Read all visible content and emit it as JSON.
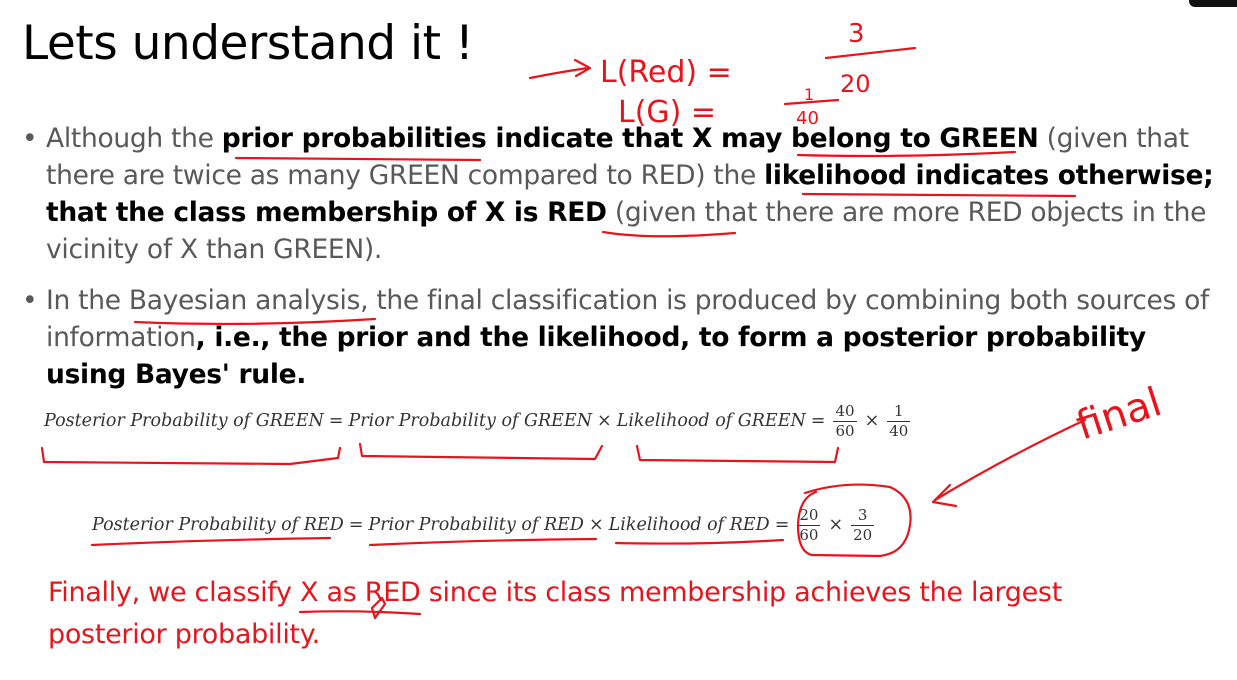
{
  "slide": {
    "title": "Lets understand it !",
    "bullet1": {
      "t1": "Although the ",
      "b1": "prior probabilities indicate that X may belong to GREEN",
      "t2": " (given that there are twice as many GREEN compared to RED) the ",
      "b2": "likelihood indicates otherwise; that the class membership of X is RED",
      "t3": " (given that there are more RED objects in the vicinity of X than GREEN)."
    },
    "bullet2": {
      "t1": "In the Bayesian analysis, the final classification is produced by combining both sources of information",
      "b1": ", i.e., the prior and the likelihood, to form a posterior probability using Bayes' rule."
    },
    "formula_green": {
      "posterior": "Posterior Probability of GREEN",
      "eq": "=",
      "prior": "Prior Probability of GREEN",
      "times": "×",
      "likelihood": "Likelihood of GREEN",
      "eq2": "=",
      "f1_num": "40",
      "f1_den": "60",
      "times2": "×",
      "f2_num": "1",
      "f2_den": "40"
    },
    "formula_red": {
      "posterior": "Posterior Probability of RED",
      "eq": "=",
      "prior": "Prior Probability of RED",
      "times": "×",
      "likelihood": "Likelihood of RED",
      "eq2": "=",
      "f1_num": "20",
      "f1_den": "60",
      "times2": "×",
      "f2_num": "3",
      "f2_den": "20"
    },
    "conclusion": "Finally, we classify X as RED since its class membership achieves the largest posterior probability."
  },
  "annotations": {
    "l_red": "L(Red) =",
    "l_red_num": "3",
    "l_red_den": "20",
    "l_green": "L(G) =",
    "l_green_num": "1",
    "l_green_den": "40",
    "final": "final"
  },
  "colors": {
    "body_text": "#595959",
    "bold_text": "#000000",
    "ink": "#e8141c"
  }
}
